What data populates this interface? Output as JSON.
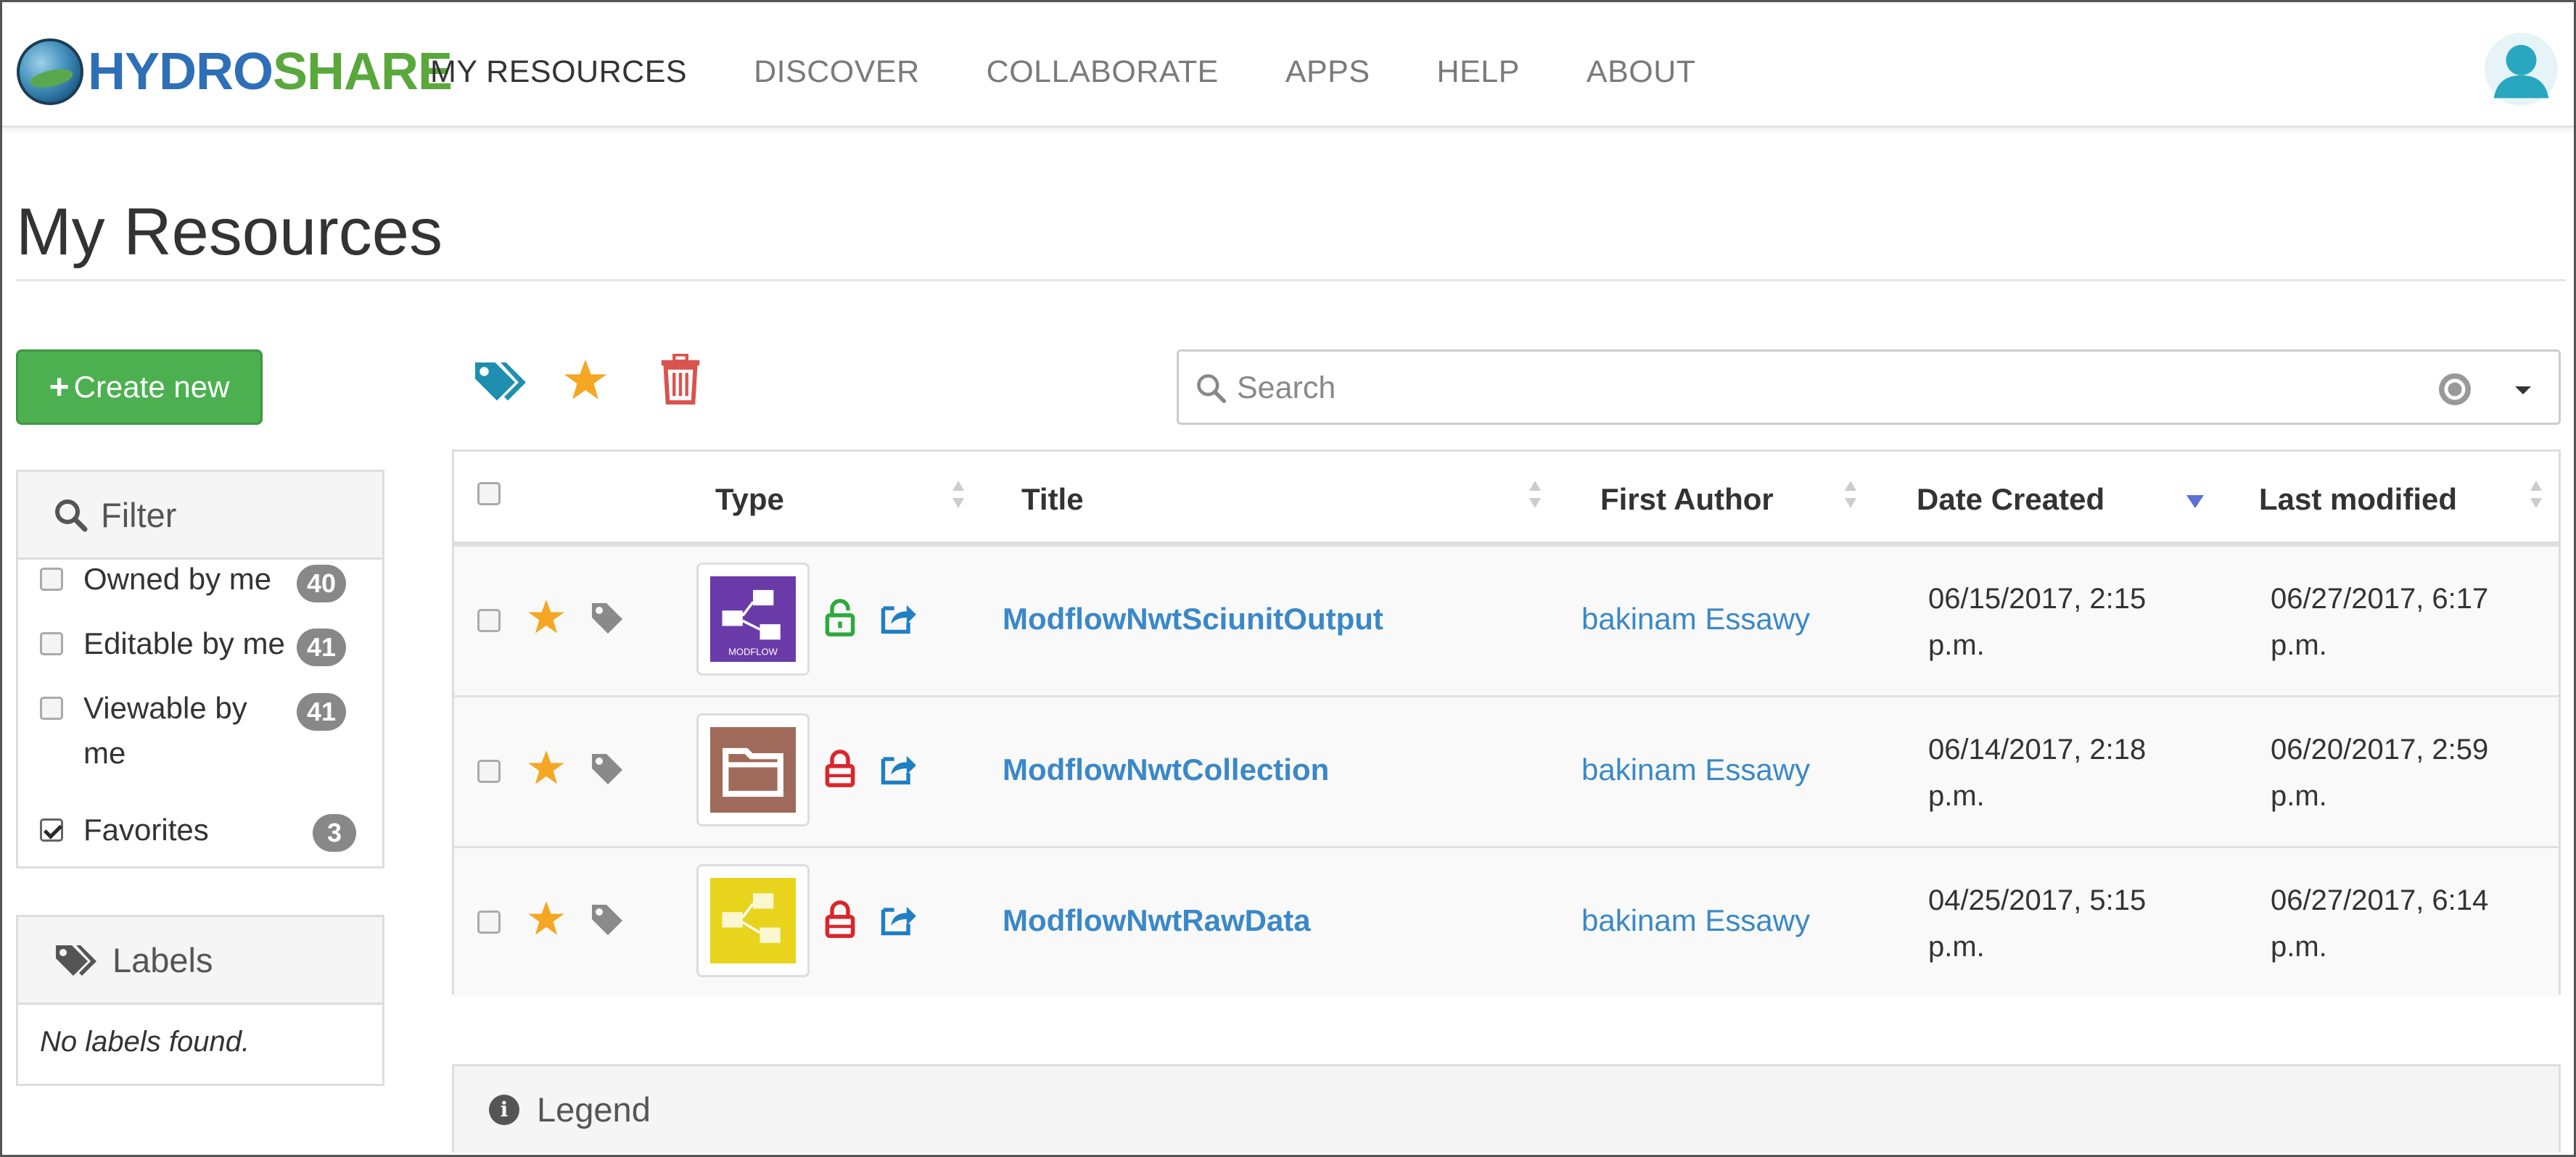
{
  "brand": {
    "logo_part1": "HYDRO",
    "logo_part2": "SHARE"
  },
  "nav": {
    "items": [
      "MY RESOURCES",
      "DISCOVER",
      "COLLABORATE",
      "APPS",
      "HELP",
      "ABOUT"
    ],
    "active": "MY RESOURCES"
  },
  "page": {
    "title": "My Resources"
  },
  "create_button": {
    "label": "Create new"
  },
  "filter": {
    "title": "Filter",
    "options": [
      {
        "label": "Owned by me",
        "count": "40",
        "checked": false
      },
      {
        "label": "Editable by me",
        "count": "41",
        "checked": false
      },
      {
        "label": "Viewable by",
        "label2": "me",
        "count": "41",
        "checked": false
      },
      {
        "label": "Favorites",
        "count": "3",
        "checked": true
      }
    ]
  },
  "labels": {
    "title": "Labels",
    "empty": "No labels found."
  },
  "search": {
    "placeholder": "Search"
  },
  "table": {
    "columns": [
      "Type",
      "Title",
      "First Author",
      "Date Created",
      "Last modified"
    ],
    "sorted_column": "Date Created",
    "rows": [
      {
        "type": "MODFLOW",
        "lock": "unlocked",
        "title": "ModflowNwtSciunitOutput",
        "author": "bakinam Essawy",
        "created": "06/15/2017, 2:15",
        "created2": "p.m.",
        "modified": "06/27/2017, 6:17",
        "modified2": "p.m."
      },
      {
        "type": "collection",
        "lock": "locked",
        "title": "ModflowNwtCollection",
        "author": "bakinam Essawy",
        "created": "06/14/2017, 2:18",
        "created2": "p.m.",
        "modified": "06/20/2017, 2:59",
        "modified2": "p.m."
      },
      {
        "type": "model-instance",
        "lock": "locked",
        "title": "ModflowNwtRawData",
        "author": "bakinam Essawy",
        "created": "04/25/2017, 5:15",
        "created2": "p.m.",
        "modified": "06/27/2017, 6:14",
        "modified2": "p.m."
      }
    ]
  },
  "legend": {
    "title": "Legend"
  },
  "colors": {
    "accent_green": "#4cb050",
    "link_blue": "#3a88c8",
    "star": "#f5a623",
    "unlocked": "#2eaa3a",
    "locked": "#d9262c",
    "trash": "#d9534f",
    "label_teal": "#1e8fae"
  }
}
